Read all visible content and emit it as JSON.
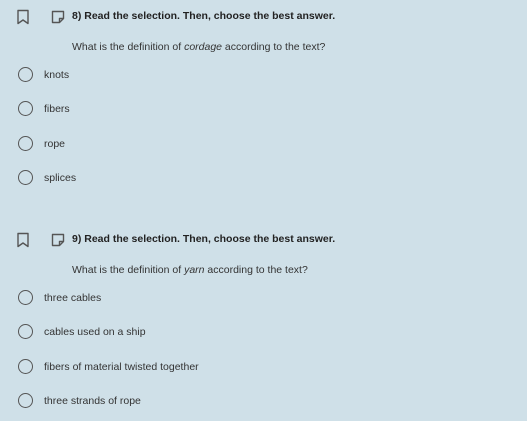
{
  "questions": [
    {
      "title": "8) Read the selection. Then, choose the best answer.",
      "prompt_before": "What is the definition of ",
      "prompt_term": "cordage",
      "prompt_after": " according to the text?",
      "options": [
        {
          "label": "knots"
        },
        {
          "label": "fibers"
        },
        {
          "label": "rope"
        },
        {
          "label": "splices"
        }
      ]
    },
    {
      "title": "9) Read the selection. Then, choose the best answer.",
      "prompt_before": "What is the definition of ",
      "prompt_term": "yarn",
      "prompt_after": " according to the text?",
      "options": [
        {
          "label": "three cables"
        },
        {
          "label": "cables used on a ship"
        },
        {
          "label": "fibers of material twisted together"
        },
        {
          "label": "three strands of rope"
        }
      ]
    }
  ],
  "icons": {
    "bookmark": "bookmark-icon",
    "note": "note-icon",
    "radio": "radio-button"
  },
  "colors": {
    "background": "#cfe0e8",
    "text": "#333333",
    "icon": "#555555"
  }
}
